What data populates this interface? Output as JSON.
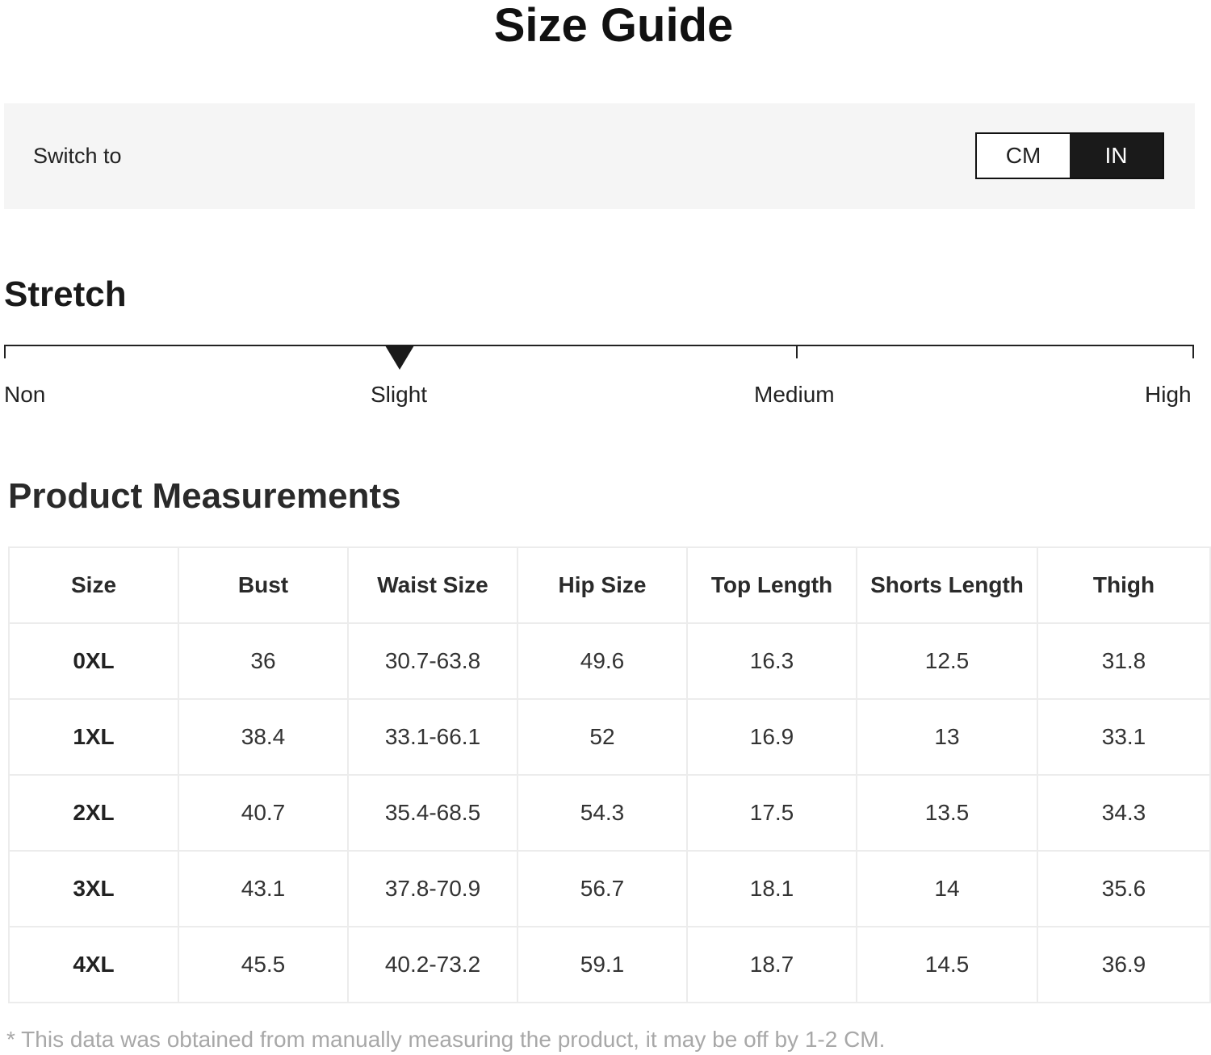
{
  "page_title": "Size Guide",
  "unit_switch": {
    "label": "Switch to",
    "options": [
      "CM",
      "IN"
    ],
    "selected": "IN"
  },
  "stretch": {
    "title": "Stretch",
    "levels": [
      "Non",
      "Slight",
      "Medium",
      "High"
    ],
    "selected": "Slight"
  },
  "measurements": {
    "title": "Product Measurements",
    "columns": [
      "Size",
      "Bust",
      "Waist Size",
      "Hip Size",
      "Top Length",
      "Shorts Length",
      "Thigh"
    ],
    "rows": [
      [
        "0XL",
        "36",
        "30.7-63.8",
        "49.6",
        "16.3",
        "12.5",
        "31.8"
      ],
      [
        "1XL",
        "38.4",
        "33.1-66.1",
        "52",
        "16.9",
        "13",
        "33.1"
      ],
      [
        "2XL",
        "40.7",
        "35.4-68.5",
        "54.3",
        "17.5",
        "13.5",
        "34.3"
      ],
      [
        "3XL",
        "43.1",
        "37.8-70.9",
        "56.7",
        "18.1",
        "14",
        "35.6"
      ],
      [
        "4XL",
        "45.5",
        "40.2-73.2",
        "59.1",
        "18.7",
        "14.5",
        "36.9"
      ]
    ]
  },
  "footnote": "* This data was obtained from manually measuring the product, it may be off by 1-2 CM."
}
